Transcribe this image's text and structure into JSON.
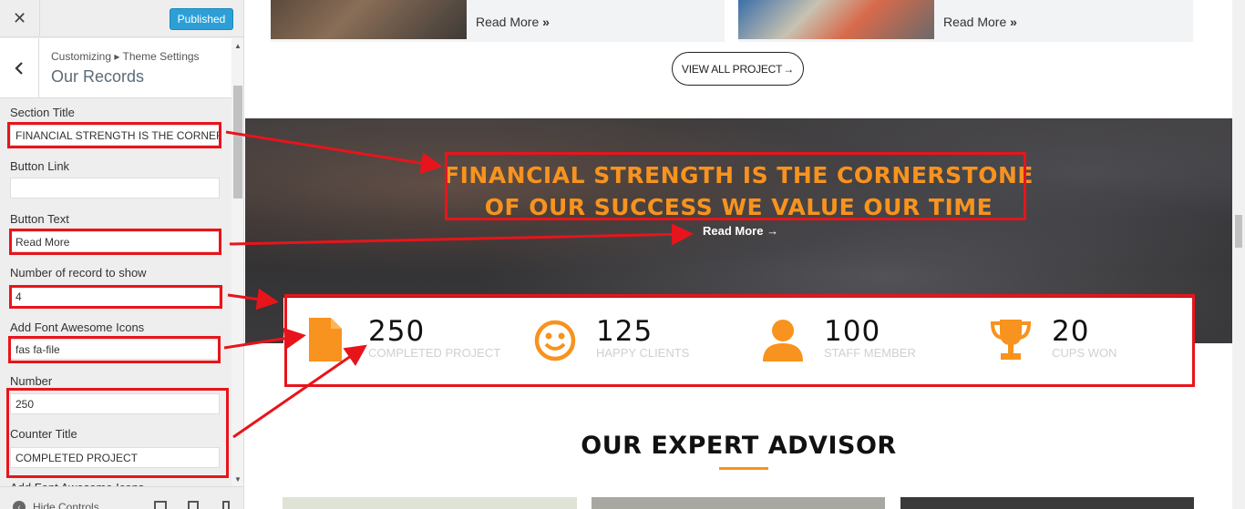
{
  "sidebar": {
    "close_icon": "close-icon",
    "publish_label": "Published",
    "breadcrumb": "Customizing ▸ Theme Settings",
    "section_title": "Our Records",
    "fields": [
      {
        "label": "Section Title",
        "value": "FINANCIAL STRENGTH IS THE CORNERS"
      },
      {
        "label": "Button Link",
        "value": ""
      },
      {
        "label": "Button Text",
        "value": "Read More"
      },
      {
        "label": "Number of record to show",
        "value": "4"
      },
      {
        "label": "Add Font Awesome Icons",
        "value": "fas fa-file"
      },
      {
        "label": "Number",
        "value": "250"
      },
      {
        "label": "Counter Title",
        "value": "COMPLETED PROJECT"
      },
      {
        "label": "Add Font Awesome Icons",
        "value": ""
      }
    ],
    "hide_controls": "Hide Controls"
  },
  "preview": {
    "projects": [
      {
        "read_more": "Read More"
      },
      {
        "read_more": "Read More"
      }
    ],
    "view_all": "VIEW ALL PROJECT",
    "hero": {
      "title_line1": "FINANCIAL STRENGTH IS THE CORNERSTONE",
      "title_line2": "OF OUR SUCCESS WE VALUE OUR TIME",
      "read_more": "Read More"
    },
    "counters": [
      {
        "number": "250",
        "label": "COMPLETED PROJECT",
        "icon": "file-icon"
      },
      {
        "number": "125",
        "label": "HAPPY CLIENTS",
        "icon": "smile-icon"
      },
      {
        "number": "100",
        "label": "STAFF MEMBER",
        "icon": "user-icon"
      },
      {
        "number": "20",
        "label": "CUPS WON",
        "icon": "trophy-icon"
      }
    ],
    "advisor_title": "OUR EXPERT ADVISOR"
  },
  "colors": {
    "accent": "#f7931e",
    "annotation": "#e8141b",
    "publish": "#2c9fd6"
  }
}
